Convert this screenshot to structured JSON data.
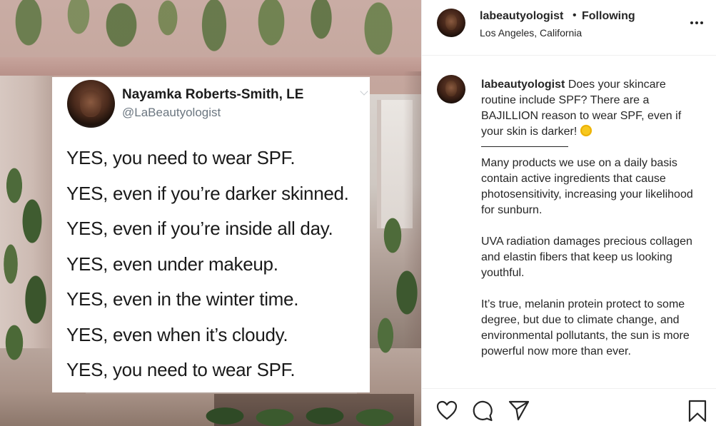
{
  "post_image": {
    "tweet": {
      "name": "Nayamka Roberts-Smith, LE",
      "handle": "@LaBeautyologist",
      "lines": [
        "YES, you need to wear SPF.",
        "YES, even if you’re darker skinned.",
        "YES, even if you’re inside all day.",
        "YES, even under makeup.",
        "YES, even in the winter time.",
        "YES, even when it’s cloudy.",
        "YES, you need to wear SPF."
      ]
    }
  },
  "header": {
    "username": "labeautyologist",
    "separator": "•",
    "follow_status": "Following",
    "location": "Los Angeles, California",
    "more_icon": "more-horizontal-icon"
  },
  "caption": {
    "username": "labeautyologist",
    "intro": "Does your skincare routine include SPF? There are a BAJILLION reason to wear SPF, even if your skin is darker!",
    "emoji": "sun-emoji",
    "paragraphs": [
      "Many products we use on a daily basis contain active ingredients that cause photosensitivity, increasing your likelihood for sunburn.",
      "UVA radiation damages precious collagen and elastin fibers that keep us looking youthful.",
      "It’s true, melanin protein protect to some degree, but due to climate change, and environmental pollutants, the sun is more powerful now more than ever."
    ]
  },
  "actions": {
    "icons": [
      "heart-icon",
      "comment-icon",
      "share-icon",
      "bookmark-icon"
    ]
  },
  "colors": {
    "text": "#262626",
    "handle_gray": "#6b7680",
    "divider": "#efefef"
  }
}
